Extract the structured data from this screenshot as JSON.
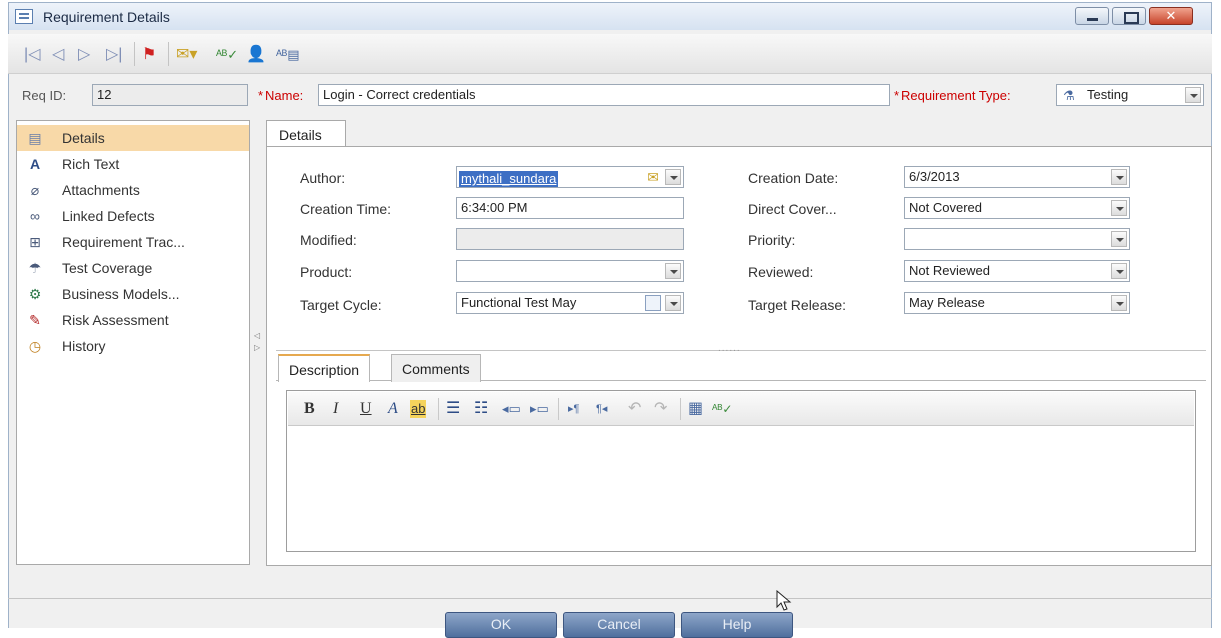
{
  "window": {
    "title": "Requirement Details",
    "close_glyph": "✕"
  },
  "toolbar": {
    "icons": [
      "first-record-icon",
      "previous-record-icon",
      "next-record-icon",
      "last-record-icon",
      "flag-icon",
      "send-email-icon",
      "spell-check-icon",
      "user-icon",
      "thesaurus-icon"
    ]
  },
  "header": {
    "req_id_label": "Req ID:",
    "req_id_value": "12",
    "name_required": "*",
    "name_label": "Name:",
    "name_value": "Login - Correct credentials",
    "type_required": "*",
    "type_label": "Requirement Type:",
    "type_value": "Testing"
  },
  "nav": {
    "items": [
      {
        "label": "Details",
        "icon": "details-icon",
        "selected": true
      },
      {
        "label": "Rich Text",
        "icon": "rich-text-icon"
      },
      {
        "label": "Attachments",
        "icon": "paperclip-icon"
      },
      {
        "label": "Linked Defects",
        "icon": "link-icon"
      },
      {
        "label": "Requirement Trac...",
        "icon": "traceability-icon"
      },
      {
        "label": "Test Coverage",
        "icon": "coverage-icon"
      },
      {
        "label": "Business Models...",
        "icon": "business-models-icon"
      },
      {
        "label": "Risk Assessment",
        "icon": "risk-icon"
      },
      {
        "label": "History",
        "icon": "history-icon"
      }
    ]
  },
  "details": {
    "tab_label": "Details",
    "author_label": "Author:",
    "author_value": "mythali_sundara",
    "creation_time_label": "Creation Time:",
    "creation_time_value": "6:34:00 PM",
    "modified_label": "Modified:",
    "modified_value": "",
    "product_label": "Product:",
    "product_value": "",
    "target_cycle_label": "Target Cycle:",
    "target_cycle_value": "Functional Test May",
    "creation_date_label": "Creation Date:",
    "creation_date_value": "6/3/2013",
    "direct_cover_label": "Direct Cover...",
    "direct_cover_value": "Not Covered",
    "priority_label": "Priority:",
    "priority_value": "",
    "reviewed_label": "Reviewed:",
    "reviewed_value": "Not Reviewed",
    "target_release_label": "Target Release:",
    "target_release_value": "May Release"
  },
  "description": {
    "tabs": [
      "Description",
      "Comments"
    ],
    "toolbar": {
      "bold": "B",
      "italic": "I",
      "underline": "U",
      "font_color": "A",
      "highlight": "ab"
    }
  },
  "dialog": {
    "ok": "OK",
    "cancel": "Cancel",
    "help": "Help"
  }
}
